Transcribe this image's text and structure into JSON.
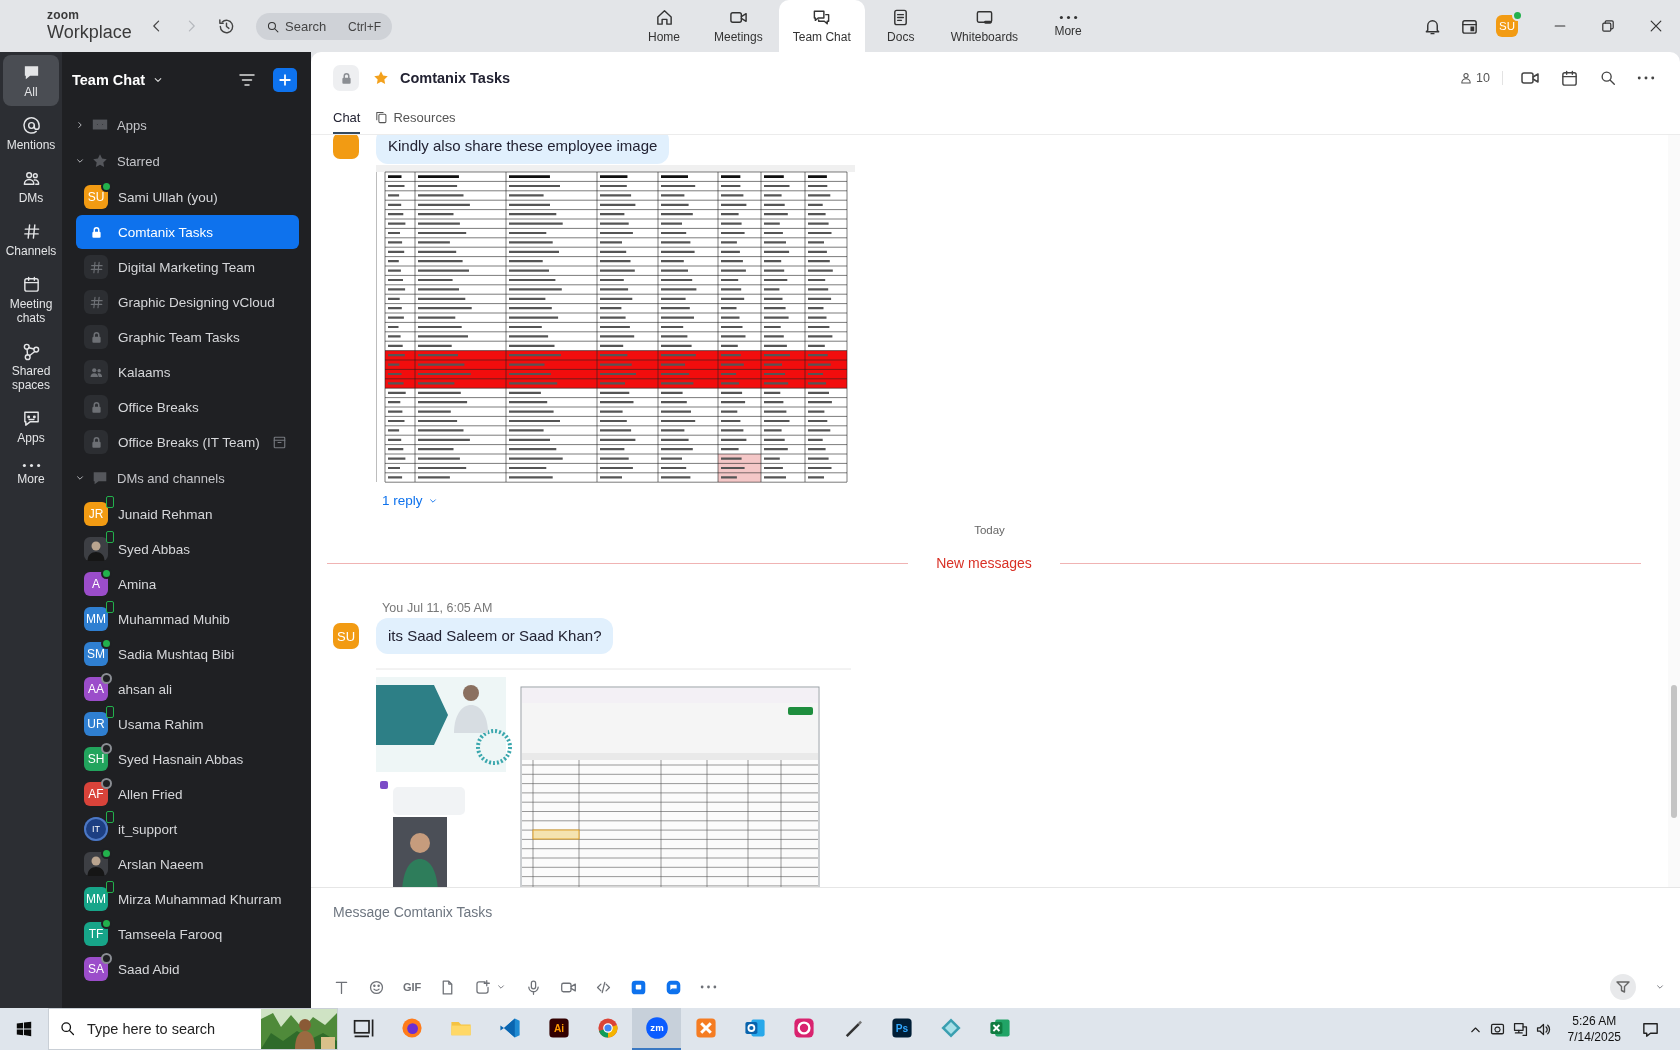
{
  "topbar": {
    "logo_top": "zoom",
    "logo_bottom": "Workplace",
    "search": {
      "placeholder": "Search",
      "shortcut": "Ctrl+F"
    },
    "nav": [
      {
        "label": "Home",
        "selected": false
      },
      {
        "label": "Meetings",
        "selected": false
      },
      {
        "label": "Team Chat",
        "selected": true
      },
      {
        "label": "Docs",
        "selected": false
      },
      {
        "label": "Whiteboards",
        "selected": false
      },
      {
        "label": "More",
        "selected": false
      }
    ],
    "avatar": {
      "initials": "SU",
      "color": "#f29b13",
      "online": true
    }
  },
  "rail": [
    {
      "label": "All",
      "selected": true
    },
    {
      "label": "Mentions",
      "selected": false
    },
    {
      "label": "DMs",
      "selected": false
    },
    {
      "label": "Channels",
      "selected": false
    },
    {
      "label": "Meeting chats",
      "selected": false
    },
    {
      "label": "Shared spaces",
      "selected": false
    },
    {
      "label": "Apps",
      "selected": false
    },
    {
      "label": "More",
      "selected": false
    }
  ],
  "sidebar": {
    "title": "Team Chat",
    "sections": [
      {
        "label": "Apps",
        "expanded": false
      },
      {
        "label": "Starred",
        "expanded": true,
        "items": [
          {
            "name": "Sami Ullah (you)",
            "kind": "avatar",
            "initials": "SU",
            "color": "#f29b13",
            "online": true,
            "mobile": false,
            "selected": false
          },
          {
            "name": "Comtanix Tasks",
            "kind": "lock",
            "selected": true
          },
          {
            "name": "Digital Marketing Team",
            "kind": "hash",
            "selected": false
          },
          {
            "name": "Graphic Designing vCloud",
            "kind": "hash",
            "selected": false
          },
          {
            "name": "Graphic Team Tasks",
            "kind": "lock",
            "selected": false
          },
          {
            "name": "Kalaams",
            "kind": "group",
            "selected": false
          },
          {
            "name": "Office Breaks",
            "kind": "lock",
            "selected": false
          },
          {
            "name": "Office Breaks (IT Team)",
            "kind": "lock",
            "archived": true,
            "selected": false
          }
        ]
      },
      {
        "label": "DMs and channels",
        "expanded": true,
        "items": [
          {
            "name": "Junaid Rehman",
            "kind": "avatar",
            "initials": "JR",
            "color": "#f29b13",
            "online": true,
            "mobile": true,
            "selected": false
          },
          {
            "name": "Syed Abbas",
            "online": true,
            "mobile": true,
            "selected": false
          },
          {
            "name": "Amina",
            "kind": "avatar",
            "initials": "A",
            "color": "#9b4dca",
            "online": true,
            "mobile": false,
            "selected": false
          },
          {
            "name": "Muhammad Muhib",
            "kind": "avatar",
            "initials": "MM",
            "color": "#2f7fd1",
            "online": true,
            "mobile": true,
            "selected": false
          },
          {
            "name": "Sadia Mushtaq Bibi",
            "kind": "avatar",
            "initials": "SM",
            "color": "#2f7fd1",
            "online": true,
            "mobile": false,
            "selected": false
          },
          {
            "name": "ahsan ali",
            "kind": "avatar",
            "initials": "AA",
            "color": "#9b4dca",
            "online": false,
            "mobile": false,
            "selected": false
          },
          {
            "name": "Usama Rahim",
            "kind": "avatar",
            "initials": "UR",
            "color": "#2f7fd1",
            "online": true,
            "mobile": true,
            "selected": false
          },
          {
            "name": "Syed Hasnain Abbas",
            "kind": "avatar",
            "initials": "SH",
            "color": "#22a45d",
            "online": false,
            "mobile": false,
            "selected": false
          },
          {
            "name": "Allen Fried",
            "kind": "avatar",
            "initials": "AF",
            "color": "#d9433a",
            "online": false,
            "mobile": false,
            "selected": false
          },
          {
            "name": "it_support",
            "kind": "logo",
            "initials": "IT",
            "online": true,
            "mobile": true,
            "selected": false
          },
          {
            "name": "Arslan Naeem",
            "online": true,
            "mobile": false,
            "selected": false
          },
          {
            "name": "Mirza Muhammad Khurram",
            "kind": "avatar",
            "initials": "MM",
            "color": "#17a589",
            "online": true,
            "mobile": true,
            "selected": false
          },
          {
            "name": "Tamseela Farooq",
            "kind": "avatar",
            "initials": "TF",
            "color": "#17a589",
            "online": true,
            "mobile": false,
            "selected": false
          },
          {
            "name": "Saad Abid",
            "kind": "avatar",
            "initials": "SA",
            "color": "#9b4dca",
            "online": false,
            "mobile": false,
            "selected": false
          }
        ]
      }
    ]
  },
  "chat": {
    "title": "Comtanix Tasks",
    "private": true,
    "starred": true,
    "members": "10",
    "tabs": [
      {
        "label": "Chat",
        "selected": true
      },
      {
        "label": "Resources",
        "selected": false
      }
    ],
    "messages": [
      {
        "kind": "message",
        "color": "#f29b13",
        "text": "Kindly also share these employee image",
        "attachment": {
          "kind": "spreadsheet"
        },
        "replies": "1 reply"
      },
      {
        "kind": "date",
        "label": "Today"
      },
      {
        "kind": "new",
        "label": "New messages"
      },
      {
        "kind": "message",
        "sender": "You",
        "time": "Jul 11, 6:05 AM",
        "avatar": "SU",
        "color": "#f29b13",
        "text": "its Saad Saleem or Saad Khan?",
        "attachment": {
          "kind": "screenshot"
        }
      }
    ],
    "composer": {
      "placeholder": "Message Comtanix Tasks",
      "gif": "GIF"
    }
  },
  "taskbar": {
    "search_placeholder": "Type here to search",
    "apps": [
      {
        "kind": "taskview",
        "selected": false
      },
      {
        "kind": "firefox",
        "selected": false
      },
      {
        "kind": "files",
        "selected": false
      },
      {
        "kind": "vscode",
        "selected": false
      },
      {
        "kind": "ai",
        "label": "Ai",
        "selected": false
      },
      {
        "kind": "chrome",
        "selected": false
      },
      {
        "kind": "zoom",
        "label": "zm",
        "selected": true
      },
      {
        "kind": "xampp",
        "selected": false
      },
      {
        "kind": "outlook",
        "selected": false
      },
      {
        "kind": "cc",
        "selected": false
      },
      {
        "kind": "pen",
        "selected": false
      },
      {
        "kind": "ps",
        "label": "Ps",
        "selected": false
      },
      {
        "kind": "diamond",
        "selected": false
      },
      {
        "kind": "excel",
        "selected": false
      }
    ],
    "time": "5:26 AM",
    "date": "7/14/2025"
  }
}
